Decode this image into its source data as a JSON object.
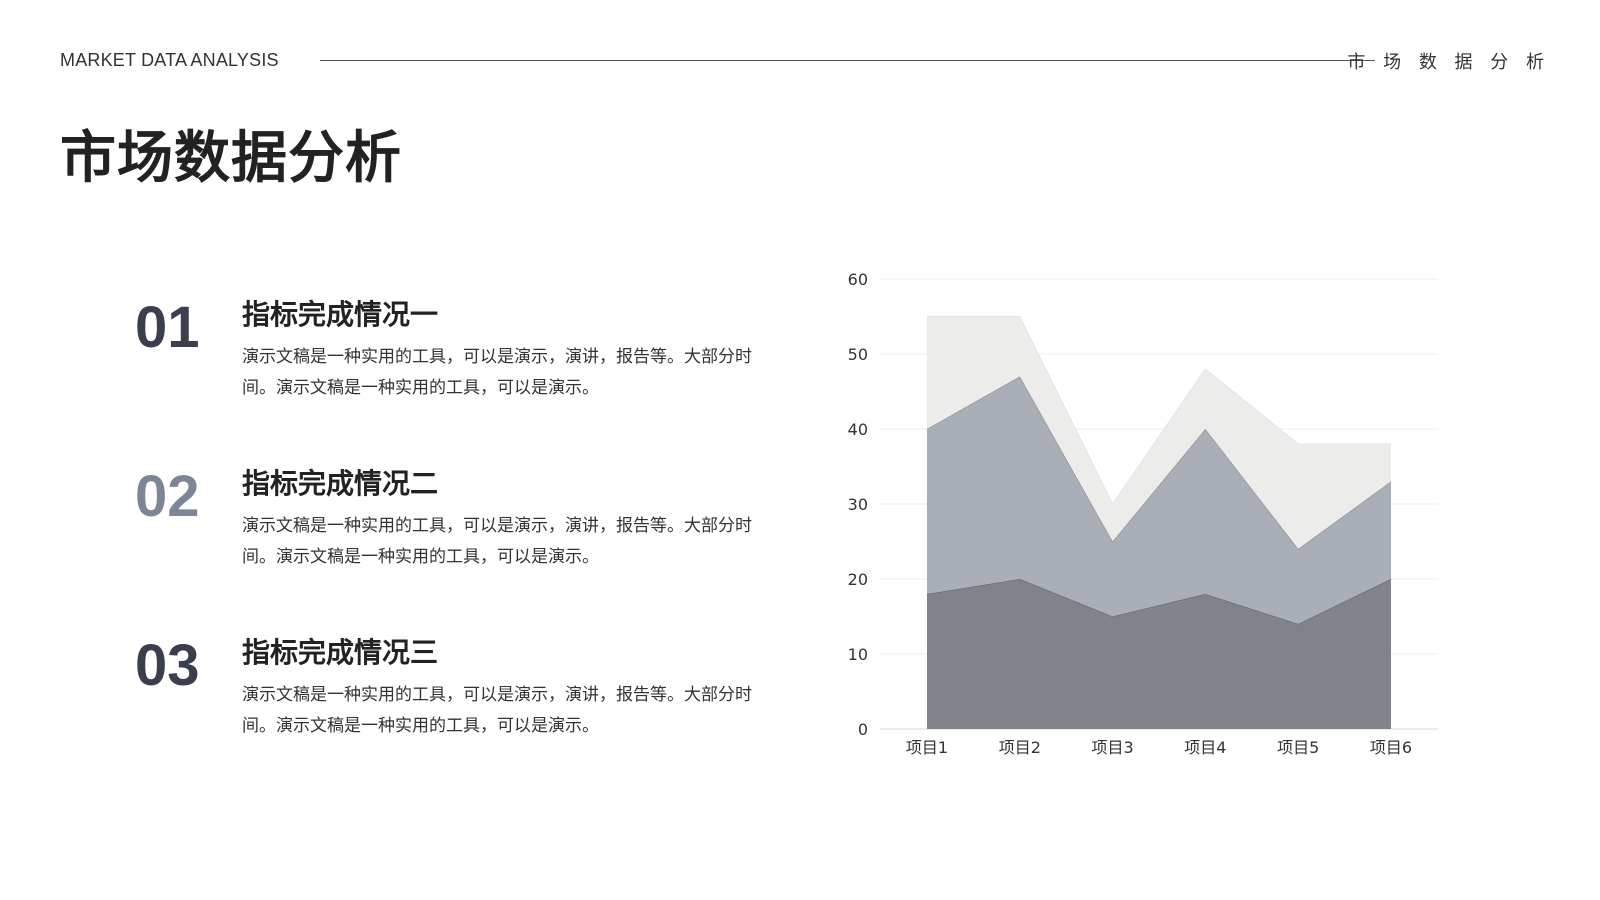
{
  "header": {
    "en_title": "MARKET DATA ANALYSIS",
    "cn_title": "市 场 数 据 分 析"
  },
  "page_title": "市场数据分析",
  "items": [
    {
      "number": "01",
      "number_color": "#3b3f4c",
      "title": "指标完成情况一",
      "desc": "演示文稿是一种实用的工具，可以是演示，演讲，报告等。大部分时间。演示文稿是一种实用的工具，可以是演示。"
    },
    {
      "number": "02",
      "number_color": "#7e8595",
      "title": "指标完成情况二",
      "desc": "演示文稿是一种实用的工具，可以是演示，演讲，报告等。大部分时间。演示文稿是一种实用的工具，可以是演示。"
    },
    {
      "number": "03",
      "number_color": "#3b3f4c",
      "title": "指标完成情况三",
      "desc": "演示文稿是一种实用的工具，可以是演示，演讲，报告等。大部分时间。演示文稿是一种实用的工具，可以是演示。"
    }
  ],
  "chart_data": {
    "type": "area",
    "stacked": true,
    "categories": [
      "项目1",
      "项目2",
      "项目3",
      "项目4",
      "项目5",
      "项目6"
    ],
    "series": [
      {
        "values": [
          18,
          20,
          15,
          18,
          14,
          20
        ],
        "color": "#80838a"
      },
      {
        "values": [
          22,
          27,
          10,
          22,
          10,
          13
        ],
        "color": "#aaaeb7"
      },
      {
        "values": [
          15,
          8,
          5,
          8,
          14,
          5
        ],
        "color": "#ececea"
      }
    ],
    "ylim": [
      0,
      60
    ],
    "yticks": [
      0,
      10,
      20,
      30,
      40,
      50,
      60
    ],
    "grid": true,
    "legend": "none"
  }
}
